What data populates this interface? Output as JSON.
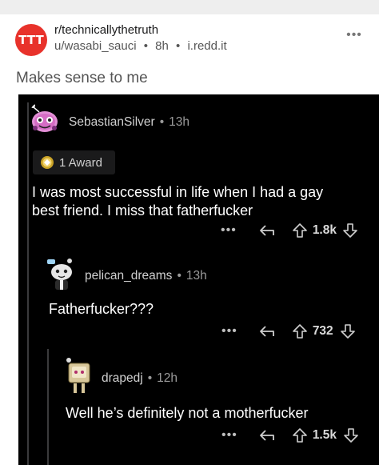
{
  "post": {
    "subreddit_avatar_text": "TTT",
    "subreddit": "r/technicallythetruth",
    "author": "u/wasabi_sauci",
    "age": "8h",
    "domain": "i.redd.it",
    "separator": "•",
    "more": "•••",
    "title": "Makes sense to me"
  },
  "comments": [
    {
      "username": "SebastianSilver",
      "separator": "•",
      "age": "13h",
      "award": "1 Award",
      "text_line1": "I was most successful in life when I had a gay",
      "text_line2": "best friend. I miss that fatherfucker",
      "more": "•••",
      "score": "1.8k"
    },
    {
      "username": "pelican_dreams",
      "separator": "•",
      "age": "13h",
      "text": "Fatherfucker???",
      "more": "•••",
      "score": "732"
    },
    {
      "username": "drapedj",
      "separator": "•",
      "age": "12h",
      "text": "Well he’s definitely not a motherfucker",
      "more": "•••",
      "score": "1.5k"
    }
  ],
  "colors": {
    "subreddit_avatar": "#e8322b",
    "dark_bg": "#000000",
    "thread_line": "#3a3a3c"
  },
  "icons": [
    "more-icon",
    "reply-icon",
    "upvote-icon",
    "downvote-icon",
    "award-icon"
  ]
}
